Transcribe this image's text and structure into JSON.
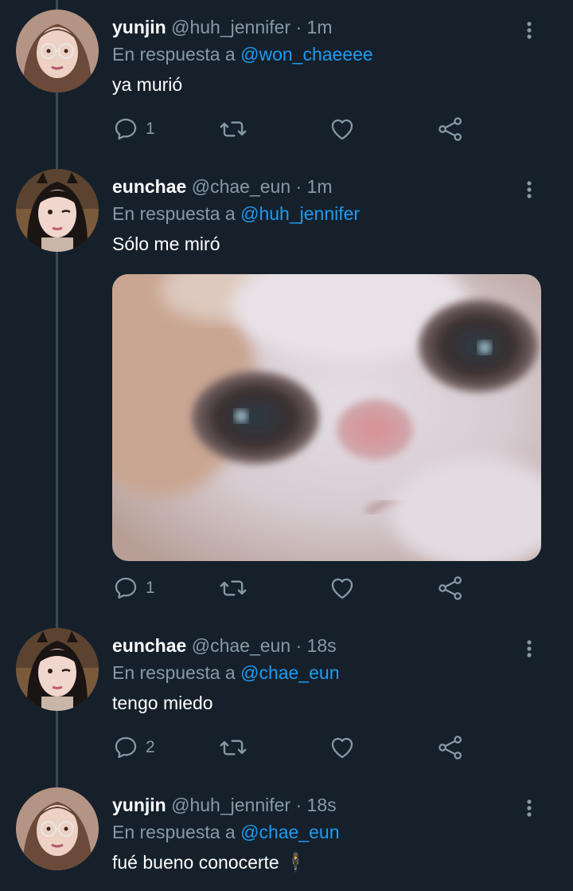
{
  "tweets": [
    {
      "name": "yunjin",
      "handle": "@huh_jennifer",
      "sep": "·",
      "time": "1m",
      "reply_prefix": "En respuesta a",
      "reply_to": "@won_chaeeee",
      "text": "ya murió",
      "replies": "1",
      "avatar_icon": "avatar-yunjin"
    },
    {
      "name": "eunchae",
      "handle": "@chae_eun",
      "sep": "·",
      "time": "1m",
      "reply_prefix": "En respuesta a",
      "reply_to": "@huh_jennifer",
      "text": "Sólo me miró",
      "replies": "1",
      "avatar_icon": "avatar-eunchae",
      "media": "cat-closeup-photo"
    },
    {
      "name": "eunchae",
      "handle": "@chae_eun",
      "sep": "·",
      "time": "18s",
      "reply_prefix": "En respuesta a",
      "reply_to": "@chae_eun",
      "text": "tengo miedo",
      "replies": "2",
      "avatar_icon": "avatar-eunchae"
    },
    {
      "name": "yunjin",
      "handle": "@huh_jennifer",
      "sep": "·",
      "time": "18s",
      "reply_prefix": "En respuesta a",
      "reply_to": "@chae_eun",
      "text": "fué bueno conocerte 🕴",
      "avatar_icon": "avatar-yunjin"
    }
  ],
  "icons": [
    "more-vertical-icon",
    "reply-icon",
    "retweet-icon",
    "like-icon",
    "share-icon"
  ],
  "colors": {
    "background": "#15202b",
    "secondary_text": "#8899a6",
    "mention": "#1d9bf0",
    "thread_line": "#3d4a56"
  }
}
